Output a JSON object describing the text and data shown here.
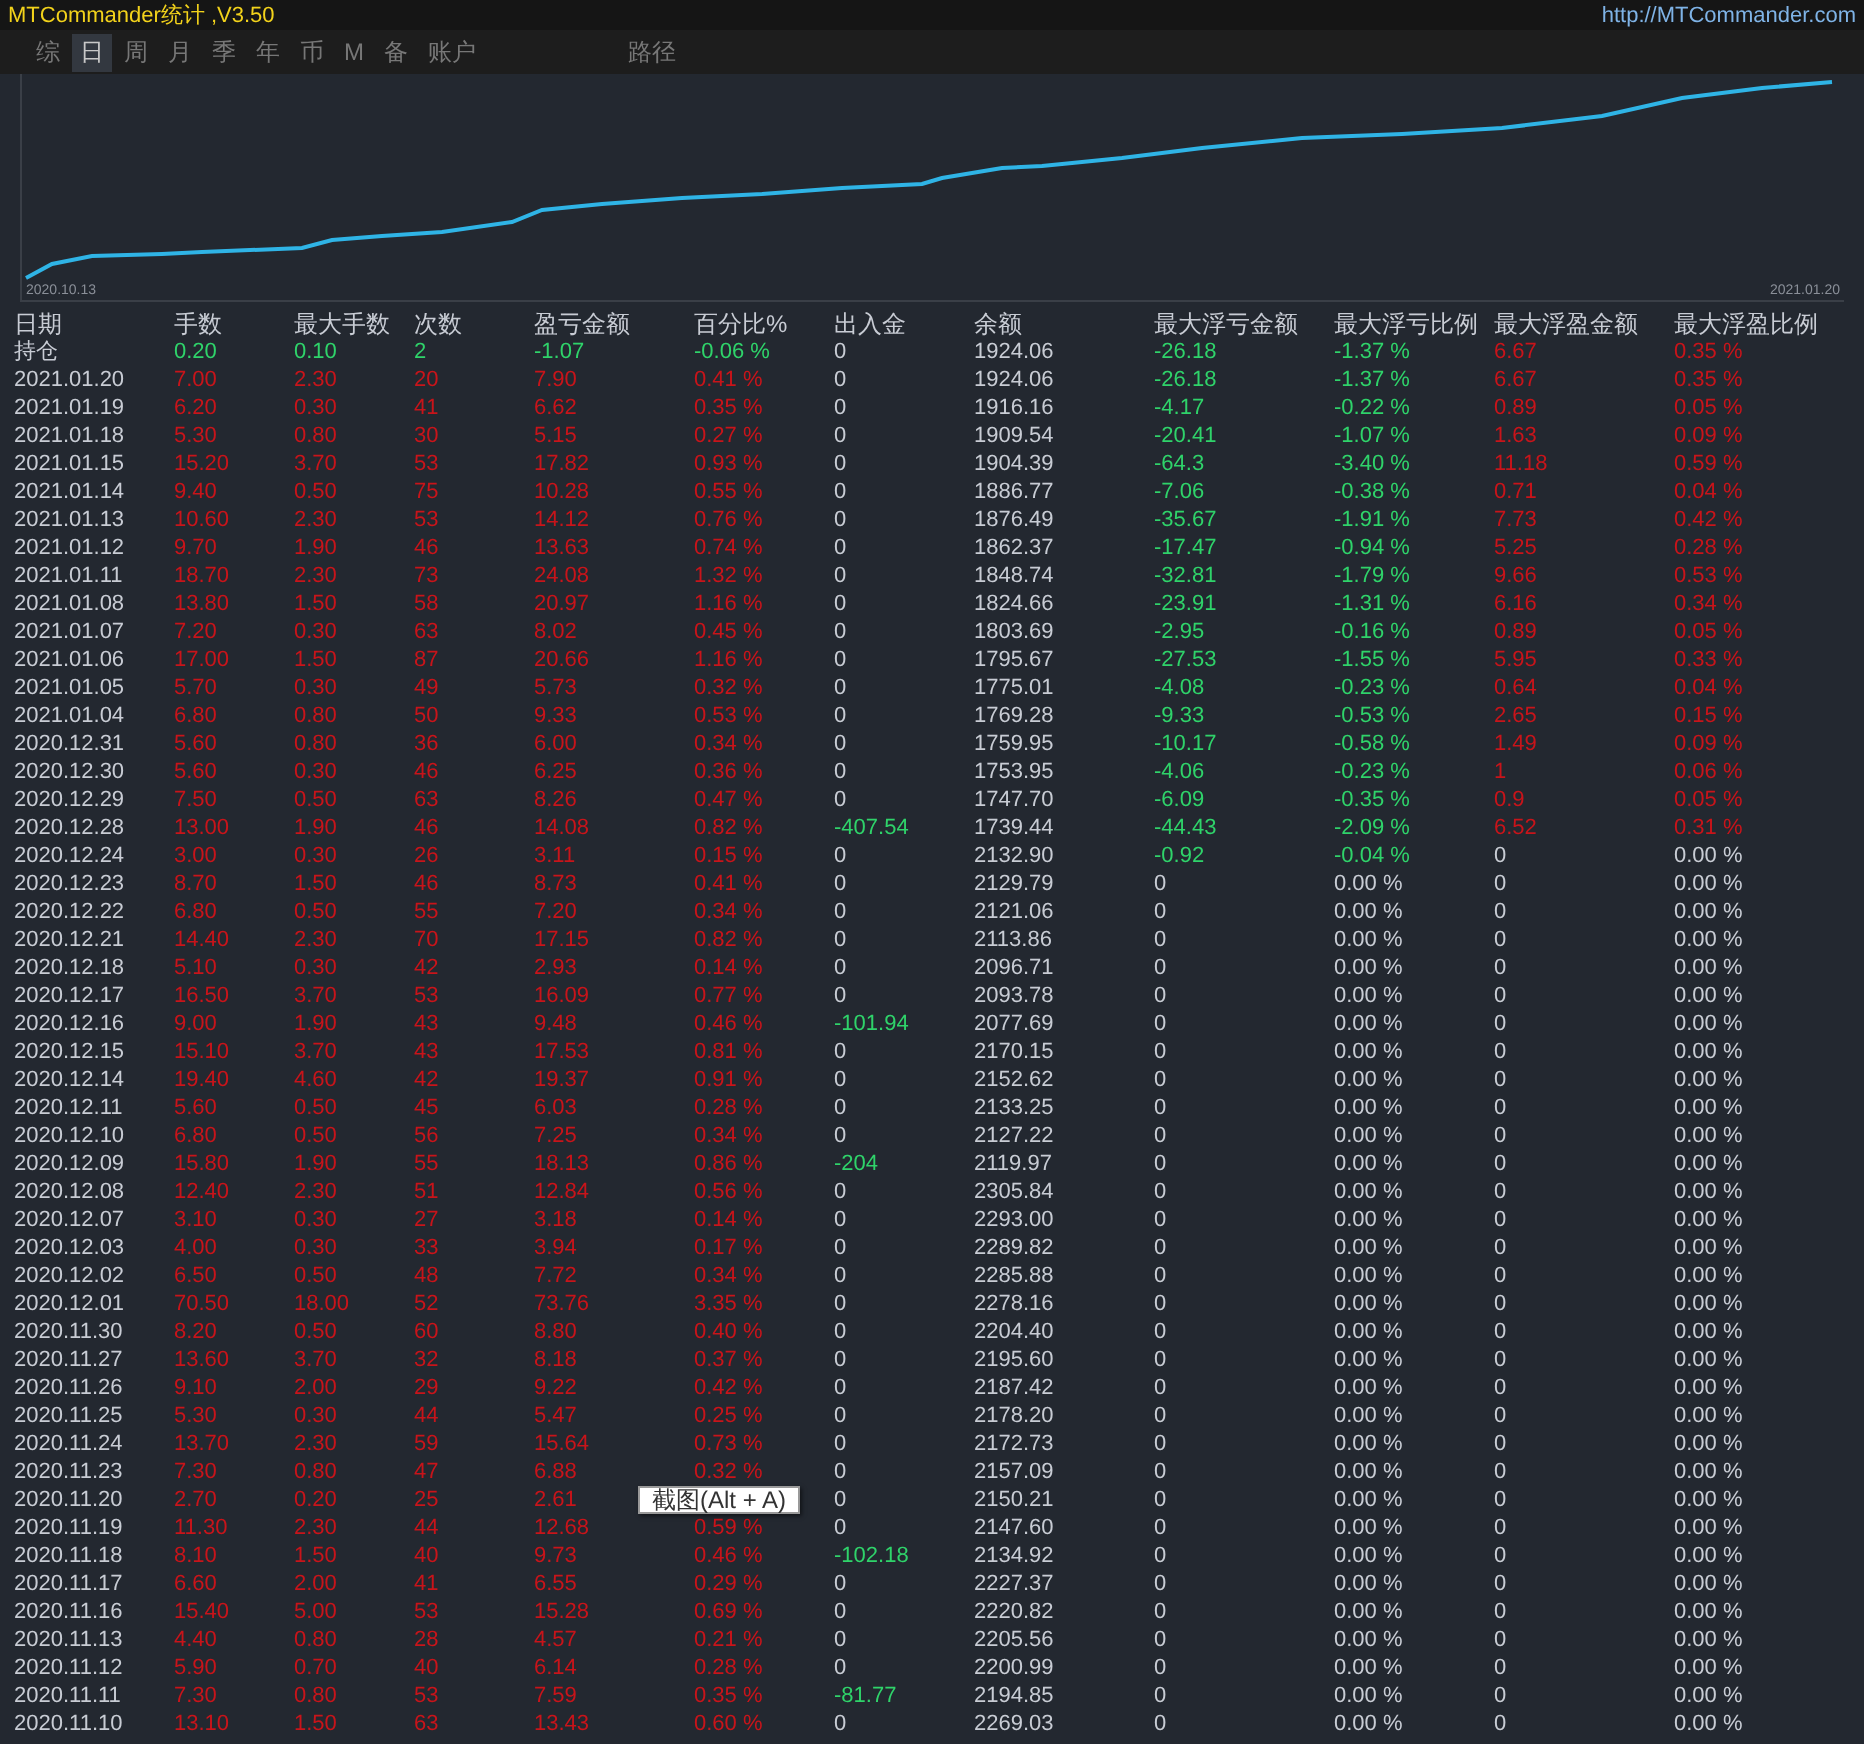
{
  "window": {
    "title": "MTCommander统计 ,V3.50",
    "url": "http://MTCommander.com"
  },
  "tabs": [
    {
      "label": "综",
      "selected": false
    },
    {
      "label": "日",
      "selected": true
    },
    {
      "label": "周",
      "selected": false
    },
    {
      "label": "月",
      "selected": false
    },
    {
      "label": "季",
      "selected": false
    },
    {
      "label": "年",
      "selected": false
    },
    {
      "label": "币",
      "selected": false
    },
    {
      "label": "M",
      "selected": false
    },
    {
      "label": "备",
      "selected": false
    },
    {
      "label": "账户",
      "selected": false
    }
  ],
  "path_label": "路径",
  "chart": {
    "start_date": "2020.10.13",
    "end_date": "2021.01.20"
  },
  "table": {
    "columns": [
      "日期",
      "手数",
      "最大手数",
      "次数",
      "盈亏金额",
      "百分比%",
      "出入金",
      "余额",
      "最大浮亏金额",
      "最大浮亏比例",
      "最大浮盈金额",
      "最大浮盈比例"
    ],
    "rows": [
      {
        "kind": "position",
        "transfer": false,
        "float_loss": true,
        "float_profit": true,
        "cells": [
          "持仓",
          "0.20",
          "0.10",
          "2",
          "-1.07",
          "-0.06 %",
          "0",
          "1924.06",
          "-26.18",
          "-1.37 %",
          "6.67",
          "0.35 %"
        ]
      },
      {
        "kind": "day",
        "transfer": false,
        "float_loss": true,
        "float_profit": true,
        "cells": [
          "2021.01.20",
          "7.00",
          "2.30",
          "20",
          "7.90",
          "0.41 %",
          "0",
          "1924.06",
          "-26.18",
          "-1.37 %",
          "6.67",
          "0.35 %"
        ]
      },
      {
        "kind": "day",
        "transfer": false,
        "float_loss": true,
        "float_profit": true,
        "cells": [
          "2021.01.19",
          "6.20",
          "0.30",
          "41",
          "6.62",
          "0.35 %",
          "0",
          "1916.16",
          "-4.17",
          "-0.22 %",
          "0.89",
          "0.05 %"
        ]
      },
      {
        "kind": "day",
        "transfer": false,
        "float_loss": true,
        "float_profit": true,
        "cells": [
          "2021.01.18",
          "5.30",
          "0.80",
          "30",
          "5.15",
          "0.27 %",
          "0",
          "1909.54",
          "-20.41",
          "-1.07 %",
          "1.63",
          "0.09 %"
        ]
      },
      {
        "kind": "day",
        "transfer": false,
        "float_loss": true,
        "float_profit": true,
        "cells": [
          "2021.01.15",
          "15.20",
          "3.70",
          "53",
          "17.82",
          "0.93 %",
          "0",
          "1904.39",
          "-64.3",
          "-3.40 %",
          "11.18",
          "0.59 %"
        ]
      },
      {
        "kind": "day",
        "transfer": false,
        "float_loss": true,
        "float_profit": true,
        "cells": [
          "2021.01.14",
          "9.40",
          "0.50",
          "75",
          "10.28",
          "0.55 %",
          "0",
          "1886.77",
          "-7.06",
          "-0.38 %",
          "0.71",
          "0.04 %"
        ]
      },
      {
        "kind": "day",
        "transfer": false,
        "float_loss": true,
        "float_profit": true,
        "cells": [
          "2021.01.13",
          "10.60",
          "2.30",
          "53",
          "14.12",
          "0.76 %",
          "0",
          "1876.49",
          "-35.67",
          "-1.91 %",
          "7.73",
          "0.42 %"
        ]
      },
      {
        "kind": "day",
        "transfer": false,
        "float_loss": true,
        "float_profit": true,
        "cells": [
          "2021.01.12",
          "9.70",
          "1.90",
          "46",
          "13.63",
          "0.74 %",
          "0",
          "1862.37",
          "-17.47",
          "-0.94 %",
          "5.25",
          "0.28 %"
        ]
      },
      {
        "kind": "day",
        "transfer": false,
        "float_loss": true,
        "float_profit": true,
        "cells": [
          "2021.01.11",
          "18.70",
          "2.30",
          "73",
          "24.08",
          "1.32 %",
          "0",
          "1848.74",
          "-32.81",
          "-1.79 %",
          "9.66",
          "0.53 %"
        ]
      },
      {
        "kind": "day",
        "transfer": false,
        "float_loss": true,
        "float_profit": true,
        "cells": [
          "2021.01.08",
          "13.80",
          "1.50",
          "58",
          "20.97",
          "1.16 %",
          "0",
          "1824.66",
          "-23.91",
          "-1.31 %",
          "6.16",
          "0.34 %"
        ]
      },
      {
        "kind": "day",
        "transfer": false,
        "float_loss": true,
        "float_profit": true,
        "cells": [
          "2021.01.07",
          "7.20",
          "0.30",
          "63",
          "8.02",
          "0.45 %",
          "0",
          "1803.69",
          "-2.95",
          "-0.16 %",
          "0.89",
          "0.05 %"
        ]
      },
      {
        "kind": "day",
        "transfer": false,
        "float_loss": true,
        "float_profit": true,
        "cells": [
          "2021.01.06",
          "17.00",
          "1.50",
          "87",
          "20.66",
          "1.16 %",
          "0",
          "1795.67",
          "-27.53",
          "-1.55 %",
          "5.95",
          "0.33 %"
        ]
      },
      {
        "kind": "day",
        "transfer": false,
        "float_loss": true,
        "float_profit": true,
        "cells": [
          "2021.01.05",
          "5.70",
          "0.30",
          "49",
          "5.73",
          "0.32 %",
          "0",
          "1775.01",
          "-4.08",
          "-0.23 %",
          "0.64",
          "0.04 %"
        ]
      },
      {
        "kind": "day",
        "transfer": false,
        "float_loss": true,
        "float_profit": true,
        "cells": [
          "2021.01.04",
          "6.80",
          "0.80",
          "50",
          "9.33",
          "0.53 %",
          "0",
          "1769.28",
          "-9.33",
          "-0.53 %",
          "2.65",
          "0.15 %"
        ]
      },
      {
        "kind": "day",
        "transfer": false,
        "float_loss": true,
        "float_profit": true,
        "cells": [
          "2020.12.31",
          "5.60",
          "0.80",
          "36",
          "6.00",
          "0.34 %",
          "0",
          "1759.95",
          "-10.17",
          "-0.58 %",
          "1.49",
          "0.09 %"
        ]
      },
      {
        "kind": "day",
        "transfer": false,
        "float_loss": true,
        "float_profit": true,
        "cells": [
          "2020.12.30",
          "5.60",
          "0.30",
          "46",
          "6.25",
          "0.36 %",
          "0",
          "1753.95",
          "-4.06",
          "-0.23 %",
          "1",
          "0.06 %"
        ]
      },
      {
        "kind": "day",
        "transfer": false,
        "float_loss": true,
        "float_profit": true,
        "cells": [
          "2020.12.29",
          "7.50",
          "0.50",
          "63",
          "8.26",
          "0.47 %",
          "0",
          "1747.70",
          "-6.09",
          "-0.35 %",
          "0.9",
          "0.05 %"
        ]
      },
      {
        "kind": "day",
        "transfer": true,
        "float_loss": true,
        "float_profit": true,
        "cells": [
          "2020.12.28",
          "13.00",
          "1.90",
          "46",
          "14.08",
          "0.82 %",
          "-407.54",
          "1739.44",
          "-44.43",
          "-2.09 %",
          "6.52",
          "0.31 %"
        ]
      },
      {
        "kind": "day",
        "transfer": false,
        "float_loss": true,
        "float_profit": false,
        "cells": [
          "2020.12.24",
          "3.00",
          "0.30",
          "26",
          "3.11",
          "0.15 %",
          "0",
          "2132.90",
          "-0.92",
          "-0.04 %",
          "0",
          "0.00 %"
        ]
      },
      {
        "kind": "day",
        "transfer": false,
        "float_loss": false,
        "float_profit": false,
        "cells": [
          "2020.12.23",
          "8.70",
          "1.50",
          "46",
          "8.73",
          "0.41 %",
          "0",
          "2129.79",
          "0",
          "0.00 %",
          "0",
          "0.00 %"
        ]
      },
      {
        "kind": "day",
        "transfer": false,
        "float_loss": false,
        "float_profit": false,
        "cells": [
          "2020.12.22",
          "6.80",
          "0.50",
          "55",
          "7.20",
          "0.34 %",
          "0",
          "2121.06",
          "0",
          "0.00 %",
          "0",
          "0.00 %"
        ]
      },
      {
        "kind": "day",
        "transfer": false,
        "float_loss": false,
        "float_profit": false,
        "cells": [
          "2020.12.21",
          "14.40",
          "2.30",
          "70",
          "17.15",
          "0.82 %",
          "0",
          "2113.86",
          "0",
          "0.00 %",
          "0",
          "0.00 %"
        ]
      },
      {
        "kind": "day",
        "transfer": false,
        "float_loss": false,
        "float_profit": false,
        "cells": [
          "2020.12.18",
          "5.10",
          "0.30",
          "42",
          "2.93",
          "0.14 %",
          "0",
          "2096.71",
          "0",
          "0.00 %",
          "0",
          "0.00 %"
        ]
      },
      {
        "kind": "day",
        "transfer": false,
        "float_loss": false,
        "float_profit": false,
        "cells": [
          "2020.12.17",
          "16.50",
          "3.70",
          "53",
          "16.09",
          "0.77 %",
          "0",
          "2093.78",
          "0",
          "0.00 %",
          "0",
          "0.00 %"
        ]
      },
      {
        "kind": "day",
        "transfer": true,
        "float_loss": false,
        "float_profit": false,
        "cells": [
          "2020.12.16",
          "9.00",
          "1.90",
          "43",
          "9.48",
          "0.46 %",
          "-101.94",
          "2077.69",
          "0",
          "0.00 %",
          "0",
          "0.00 %"
        ]
      },
      {
        "kind": "day",
        "transfer": false,
        "float_loss": false,
        "float_profit": false,
        "cells": [
          "2020.12.15",
          "15.10",
          "3.70",
          "43",
          "17.53",
          "0.81 %",
          "0",
          "2170.15",
          "0",
          "0.00 %",
          "0",
          "0.00 %"
        ]
      },
      {
        "kind": "day",
        "transfer": false,
        "float_loss": false,
        "float_profit": false,
        "cells": [
          "2020.12.14",
          "19.40",
          "4.60",
          "42",
          "19.37",
          "0.91 %",
          "0",
          "2152.62",
          "0",
          "0.00 %",
          "0",
          "0.00 %"
        ]
      },
      {
        "kind": "day",
        "transfer": false,
        "float_loss": false,
        "float_profit": false,
        "cells": [
          "2020.12.11",
          "5.60",
          "0.50",
          "45",
          "6.03",
          "0.28 %",
          "0",
          "2133.25",
          "0",
          "0.00 %",
          "0",
          "0.00 %"
        ]
      },
      {
        "kind": "day",
        "transfer": false,
        "float_loss": false,
        "float_profit": false,
        "cells": [
          "2020.12.10",
          "6.80",
          "0.50",
          "56",
          "7.25",
          "0.34 %",
          "0",
          "2127.22",
          "0",
          "0.00 %",
          "0",
          "0.00 %"
        ]
      },
      {
        "kind": "day",
        "transfer": true,
        "float_loss": false,
        "float_profit": false,
        "cells": [
          "2020.12.09",
          "15.80",
          "1.90",
          "55",
          "18.13",
          "0.86 %",
          "-204",
          "2119.97",
          "0",
          "0.00 %",
          "0",
          "0.00 %"
        ]
      },
      {
        "kind": "day",
        "transfer": false,
        "float_loss": false,
        "float_profit": false,
        "cells": [
          "2020.12.08",
          "12.40",
          "2.30",
          "51",
          "12.84",
          "0.56 %",
          "0",
          "2305.84",
          "0",
          "0.00 %",
          "0",
          "0.00 %"
        ]
      },
      {
        "kind": "day",
        "transfer": false,
        "float_loss": false,
        "float_profit": false,
        "cells": [
          "2020.12.07",
          "3.10",
          "0.30",
          "27",
          "3.18",
          "0.14 %",
          "0",
          "2293.00",
          "0",
          "0.00 %",
          "0",
          "0.00 %"
        ]
      },
      {
        "kind": "day",
        "transfer": false,
        "float_loss": false,
        "float_profit": false,
        "cells": [
          "2020.12.03",
          "4.00",
          "0.30",
          "33",
          "3.94",
          "0.17 %",
          "0",
          "2289.82",
          "0",
          "0.00 %",
          "0",
          "0.00 %"
        ]
      },
      {
        "kind": "day",
        "transfer": false,
        "float_loss": false,
        "float_profit": false,
        "cells": [
          "2020.12.02",
          "6.50",
          "0.50",
          "48",
          "7.72",
          "0.34 %",
          "0",
          "2285.88",
          "0",
          "0.00 %",
          "0",
          "0.00 %"
        ]
      },
      {
        "kind": "day",
        "transfer": false,
        "float_loss": false,
        "float_profit": false,
        "cells": [
          "2020.12.01",
          "70.50",
          "18.00",
          "52",
          "73.76",
          "3.35 %",
          "0",
          "2278.16",
          "0",
          "0.00 %",
          "0",
          "0.00 %"
        ]
      },
      {
        "kind": "day",
        "transfer": false,
        "float_loss": false,
        "float_profit": false,
        "cells": [
          "2020.11.30",
          "8.20",
          "0.50",
          "60",
          "8.80",
          "0.40 %",
          "0",
          "2204.40",
          "0",
          "0.00 %",
          "0",
          "0.00 %"
        ]
      },
      {
        "kind": "day",
        "transfer": false,
        "float_loss": false,
        "float_profit": false,
        "cells": [
          "2020.11.27",
          "13.60",
          "3.70",
          "32",
          "8.18",
          "0.37 %",
          "0",
          "2195.60",
          "0",
          "0.00 %",
          "0",
          "0.00 %"
        ]
      },
      {
        "kind": "day",
        "transfer": false,
        "float_loss": false,
        "float_profit": false,
        "cells": [
          "2020.11.26",
          "9.10",
          "2.00",
          "29",
          "9.22",
          "0.42 %",
          "0",
          "2187.42",
          "0",
          "0.00 %",
          "0",
          "0.00 %"
        ]
      },
      {
        "kind": "day",
        "transfer": false,
        "float_loss": false,
        "float_profit": false,
        "cells": [
          "2020.11.25",
          "5.30",
          "0.30",
          "44",
          "5.47",
          "0.25 %",
          "0",
          "2178.20",
          "0",
          "0.00 %",
          "0",
          "0.00 %"
        ]
      },
      {
        "kind": "day",
        "transfer": false,
        "float_loss": false,
        "float_profit": false,
        "cells": [
          "2020.11.24",
          "13.70",
          "2.30",
          "59",
          "15.64",
          "0.73 %",
          "0",
          "2172.73",
          "0",
          "0.00 %",
          "0",
          "0.00 %"
        ]
      },
      {
        "kind": "day",
        "transfer": false,
        "float_loss": false,
        "float_profit": false,
        "cells": [
          "2020.11.23",
          "7.30",
          "0.80",
          "47",
          "6.88",
          "0.32 %",
          "0",
          "2157.09",
          "0",
          "0.00 %",
          "0",
          "0.00 %"
        ]
      },
      {
        "kind": "day",
        "transfer": false,
        "float_loss": false,
        "float_profit": false,
        "cells": [
          "2020.11.20",
          "2.70",
          "0.20",
          "25",
          "2.61",
          null,
          "0",
          "2150.21",
          "0",
          "0.00 %",
          "0",
          "0.00 %"
        ]
      },
      {
        "kind": "day",
        "transfer": false,
        "float_loss": false,
        "float_profit": false,
        "cells": [
          "2020.11.19",
          "11.30",
          "2.30",
          "44",
          "12.68",
          "0.59 %",
          "0",
          "2147.60",
          "0",
          "0.00 %",
          "0",
          "0.00 %"
        ]
      },
      {
        "kind": "day",
        "transfer": true,
        "float_loss": false,
        "float_profit": false,
        "cells": [
          "2020.11.18",
          "8.10",
          "1.50",
          "40",
          "9.73",
          "0.46 %",
          "-102.18",
          "2134.92",
          "0",
          "0.00 %",
          "0",
          "0.00 %"
        ]
      },
      {
        "kind": "day",
        "transfer": false,
        "float_loss": false,
        "float_profit": false,
        "cells": [
          "2020.11.17",
          "6.60",
          "2.00",
          "41",
          "6.55",
          "0.29 %",
          "0",
          "2227.37",
          "0",
          "0.00 %",
          "0",
          "0.00 %"
        ]
      },
      {
        "kind": "day",
        "transfer": false,
        "float_loss": false,
        "float_profit": false,
        "cells": [
          "2020.11.16",
          "15.40",
          "5.00",
          "53",
          "15.28",
          "0.69 %",
          "0",
          "2220.82",
          "0",
          "0.00 %",
          "0",
          "0.00 %"
        ]
      },
      {
        "kind": "day",
        "transfer": false,
        "float_loss": false,
        "float_profit": false,
        "cells": [
          "2020.11.13",
          "4.40",
          "0.80",
          "28",
          "4.57",
          "0.21 %",
          "0",
          "2205.56",
          "0",
          "0.00 %",
          "0",
          "0.00 %"
        ]
      },
      {
        "kind": "day",
        "transfer": false,
        "float_loss": false,
        "float_profit": false,
        "cells": [
          "2020.11.12",
          "5.90",
          "0.70",
          "40",
          "6.14",
          "0.28 %",
          "0",
          "2200.99",
          "0",
          "0.00 %",
          "0",
          "0.00 %"
        ]
      },
      {
        "kind": "day",
        "transfer": true,
        "float_loss": false,
        "float_profit": false,
        "cells": [
          "2020.11.11",
          "7.30",
          "0.80",
          "53",
          "7.59",
          "0.35 %",
          "-81.77",
          "2194.85",
          "0",
          "0.00 %",
          "0",
          "0.00 %"
        ]
      },
      {
        "kind": "day",
        "transfer": false,
        "float_loss": false,
        "float_profit": false,
        "cells": [
          "2020.11.10",
          "13.10",
          "1.50",
          "63",
          "13.43",
          "0.60 %",
          "0",
          "2269.03",
          "0",
          "0.00 %",
          "0",
          "0.00 %"
        ]
      }
    ]
  },
  "tooltip": {
    "text": "截图(Alt + A)"
  }
}
